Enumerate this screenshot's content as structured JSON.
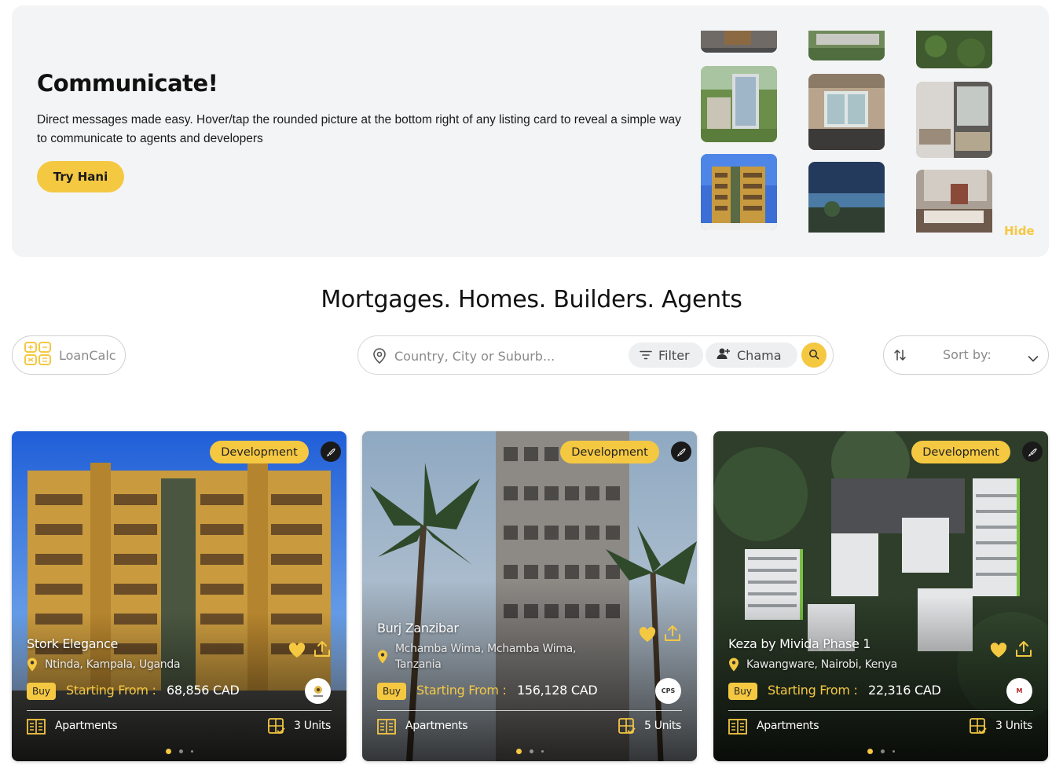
{
  "banner": {
    "title": "Communicate!",
    "text": "Direct messages made easy. Hover/tap the rounded picture at the bottom right of any listing card to reveal a simple way to communicate to agents and developers",
    "button_label": "Try Hani",
    "hide_label": "Hide"
  },
  "headline": "Mortgages. Homes. Builders. Agents",
  "toolbar": {
    "loancalc_label": "LoanCalc",
    "search_placeholder": "Country, City or Suburb...",
    "filter_label": "Filter",
    "chama_label": "Chama",
    "sort_label": "Sort by:"
  },
  "listings": [
    {
      "badge": "Development",
      "title": "Stork Elegance",
      "location": "Ntinda, Kampala, Uganda",
      "tag": "Buy",
      "starting_label": "Starting From :",
      "price": "68,856 CAD",
      "agent_logo_text": "",
      "type": "Apartments",
      "units": "3 Units",
      "slide_index": 1,
      "slide_count": 3
    },
    {
      "badge": "Development",
      "title": "Burj Zanzibar",
      "location": "Mchamba Wima, Mchamba Wima, Tanzania",
      "tag": "Buy",
      "starting_label": "Starting From :",
      "price": "156,128 CAD",
      "agent_logo_text": "CPS",
      "type": "Apartments",
      "units": "5 Units",
      "slide_index": 1,
      "slide_count": 3
    },
    {
      "badge": "Development",
      "title": "Keza by Mivida Phase 1",
      "location": "Kawangware, Nairobi, Kenya",
      "tag": "Buy",
      "starting_label": "Starting From :",
      "price": "22,316 CAD",
      "agent_logo_text": "M",
      "type": "Apartments",
      "units": "3 Units",
      "slide_index": 1,
      "slide_count": 3
    }
  ],
  "colors": {
    "accent": "#f5c842",
    "banner_bg": "#f3f4f5",
    "text_dark": "#111111",
    "muted": "#8a8a8a"
  }
}
